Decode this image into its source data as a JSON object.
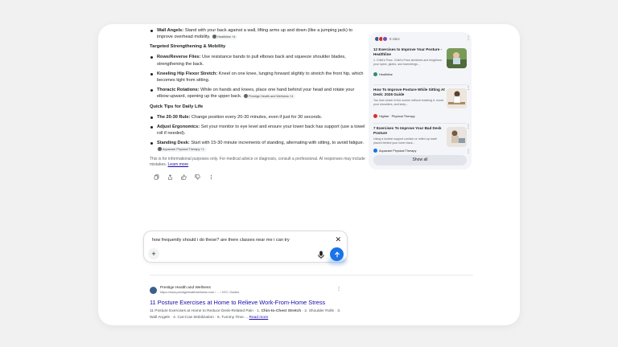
{
  "overview": {
    "bullets_top": [
      {
        "bold": "Wall Angels:",
        "text": " Stand with your back against a wall, lifting arms up and down (like a jumping jack) to improve overhead mobility.",
        "chip": "Healthline +4"
      }
    ],
    "section1": "Targeted Strengthening & Mobility",
    "bullets_s1": [
      {
        "bold": "Rows/Reverse Flies:",
        "text": " Use resistance bands to pull elbows back and squeeze shoulder blades, strengthening the back.",
        "chip": ""
      },
      {
        "bold": "Kneeling Hip Flexor Stretch:",
        "text": " Kneel on one knee, lunging forward slightly to stretch the front hip, which becomes tight from sitting.",
        "chip": ""
      },
      {
        "bold": "Thoracic Rotations:",
        "text": " While on hands and knees, place one hand behind your head and rotate your elbow upward, opening up the upper back.",
        "chip": "Prestige Health and Wellness +4"
      }
    ],
    "section2": "Quick Tips for Daily Life",
    "bullets_s2": [
      {
        "bold": "The 20-30 Rule:",
        "text": " Change position every 20-30 minutes, even if just for 30 seconds.",
        "chip": ""
      },
      {
        "bold": "Adjust Ergonomics:",
        "text": " Set your monitor to eye level and ensure your lower back has support (use a towel roll if needed).",
        "chip": ""
      },
      {
        "bold": "Standing Desk:",
        "text": " Start with 15-30 minute increments of standing, alternating with sitting, to avoid fatigue.",
        "chip": "Aquacare Physical Therapy +1"
      }
    ],
    "disclaimer": "This is for informational purposes only. For medical advice or diagnosis, consult a professional. AI responses may include mistakes.",
    "learn_more": "Learn more"
  },
  "sidebar": {
    "sites_count": "9 sites",
    "sources": [
      {
        "title": "12 Exercises to Improve Your Posture - Healthline",
        "snippet": "1. Child's Pose. Child's Pose stretches and lengthens your spine, glutes, and hamstrings...",
        "meta": "Healthline",
        "meta_color": "#2f8f6a"
      },
      {
        "title": "How To Improve Posture While Sitting At Desk: 2026 Guide",
        "snippet": "You lean closer to the screen without realizing it, round your shoulders, and keep...",
        "meta": "Hightar · Physical Therapy",
        "meta_color": "#d93025"
      },
      {
        "title": "7 Exercises To Improve Your Bad Desk Posture",
        "snippet": "Using a lumbar support cushion or rolled-up towel placed behind your lower back...",
        "meta": "Aquacare Physical Therapy",
        "meta_color": "#1a73e8"
      }
    ],
    "show_all": "Show all"
  },
  "input": {
    "text": "how frequently should i do these? are there classes near me i can try"
  },
  "result": {
    "site": "Prestige Health and Wellness",
    "url": "https://www.prestigehealthwellness.com › ... › NYC Guides",
    "title": "11 Posture Exercises at Home to Relieve Work-From-Home Stress",
    "snippet": "11 Posture Exercises at Home to Reduce Desk-Related Pain · 1. ",
    "snippet_bold": "Chin-to-Chest Stretch",
    "snippet_rest": " · 2. Shoulder Rolls · 3. Wall Angels · 4. Cat-Cow Mobilization · 5. Tummy Time ...",
    "read_more": "Read more"
  }
}
